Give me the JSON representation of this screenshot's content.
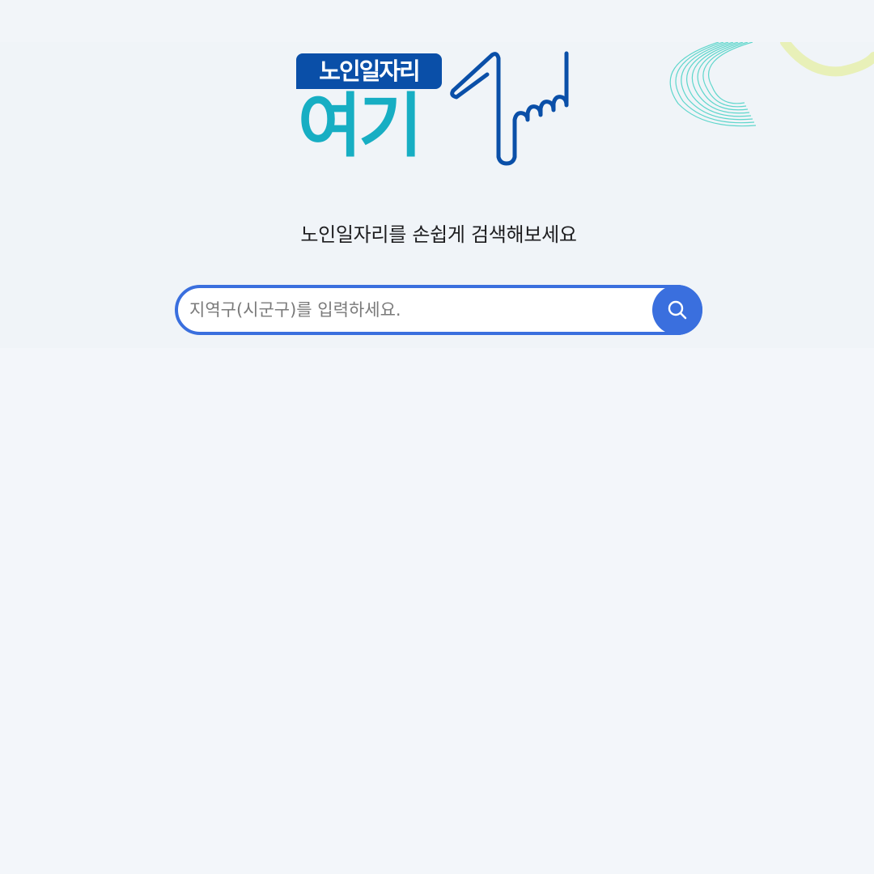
{
  "logo": {
    "badge_text": "노인일자리",
    "main_text": "여기"
  },
  "tagline": "노인일자리를 손쉽게 검색해보세요",
  "search": {
    "placeholder": "지역구(시군구)를 입력하세요.",
    "value": "",
    "button_icon": "search-icon"
  },
  "colors": {
    "accent": "#3a6fde",
    "logo_navy": "#0a4fa8",
    "logo_teal": "#17aec3",
    "background": "#f3f6fa"
  }
}
